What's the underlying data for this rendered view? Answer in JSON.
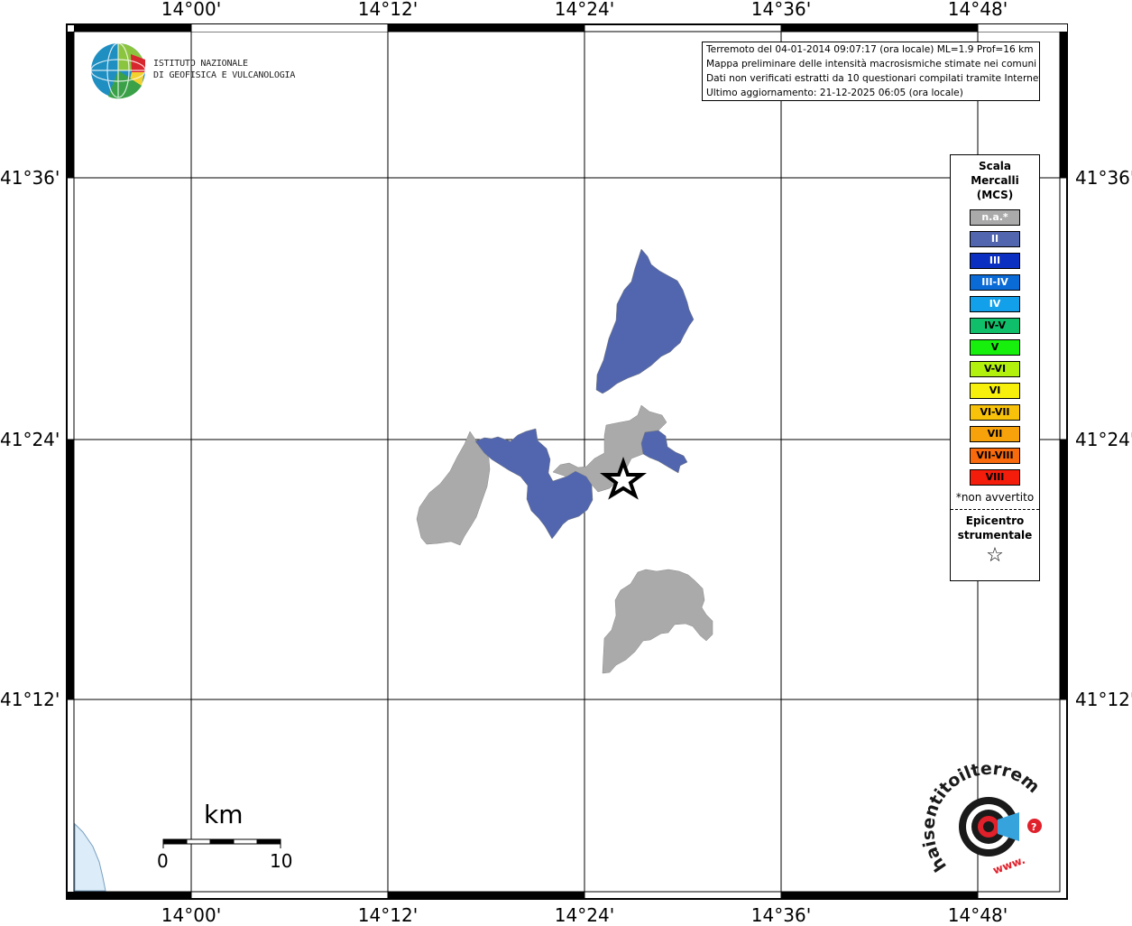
{
  "axes": {
    "lon_labels": [
      "14°00'",
      "14°12'",
      "14°24'",
      "14°36'",
      "14°48'"
    ],
    "lat_labels": [
      "41°36'",
      "41°24'",
      "41°12'"
    ]
  },
  "logo": {
    "line1": "ISTITUTO NAZIONALE",
    "line2": "DI GEOFISICA E VULCANOLOGIA"
  },
  "info_box": {
    "line1": "Terremoto del 04-01-2014 09:07:17 (ora locale) ML=1.9 Prof=16 km",
    "line2": "Mappa preliminare delle intensità macrosismiche stimate nei comuni",
    "line3": "Dati non verificati estratti da 10 questionari compilati tramite Internet.",
    "line4": "Ultimo aggiornamento: 21-12-2025 06:05 (ora locale)"
  },
  "legend": {
    "title_1": "Scala",
    "title_2": "Mercalli",
    "title_3": "(MCS)",
    "items": [
      {
        "label": "n.a.*",
        "color": "#aaaaaa",
        "text_color": "#ffffff"
      },
      {
        "label": "II",
        "color": "#5166ae",
        "text_color": "#ffffff"
      },
      {
        "label": "III",
        "color": "#0b2fc0",
        "text_color": "#ffffff"
      },
      {
        "label": "III-IV",
        "color": "#0a6ad6",
        "text_color": "#ffffff"
      },
      {
        "label": "IV",
        "color": "#12a0ea",
        "text_color": "#ffffff"
      },
      {
        "label": "IV-V",
        "color": "#0fbf6a",
        "text_color": "#000000"
      },
      {
        "label": "V",
        "color": "#17f00d",
        "text_color": "#000000"
      },
      {
        "label": "V-VI",
        "color": "#b2f00d",
        "text_color": "#000000"
      },
      {
        "label": "VI",
        "color": "#f7f00c",
        "text_color": "#000000"
      },
      {
        "label": "VI-VII",
        "color": "#f8c20b",
        "text_color": "#000000"
      },
      {
        "label": "VII",
        "color": "#f8a20b",
        "text_color": "#000000"
      },
      {
        "label": "VII-VIII",
        "color": "#f86a0b",
        "text_color": "#000000"
      },
      {
        "label": "VIII",
        "color": "#f41d0b",
        "text_color": "#000000"
      }
    ],
    "note": "*non avvertito",
    "epicenter_1": "Epicentro",
    "epicenter_2": "strumentale",
    "epicenter_symbol": "☆"
  },
  "scale_bar": {
    "unit": "km",
    "start": "0",
    "end": "10"
  },
  "watermark": {
    "text_arc": "haisentitoilterremoto.it",
    "url": "www."
  },
  "map": {
    "epicenter": {
      "lon": "14°26'",
      "lat": "41°22'"
    },
    "municipalities": [
      {
        "intensity": "II",
        "color": "#5166ae"
      },
      {
        "intensity": "II",
        "color": "#5166ae"
      },
      {
        "intensity": "II",
        "color": "#5166ae"
      },
      {
        "intensity": "n.a.*",
        "color": "#aaaaaa"
      },
      {
        "intensity": "n.a.*",
        "color": "#aaaaaa"
      },
      {
        "intensity": "n.a.*",
        "color": "#aaaaaa"
      },
      {
        "intensity": "n.a.*",
        "color": "#aaaaaa"
      }
    ]
  }
}
